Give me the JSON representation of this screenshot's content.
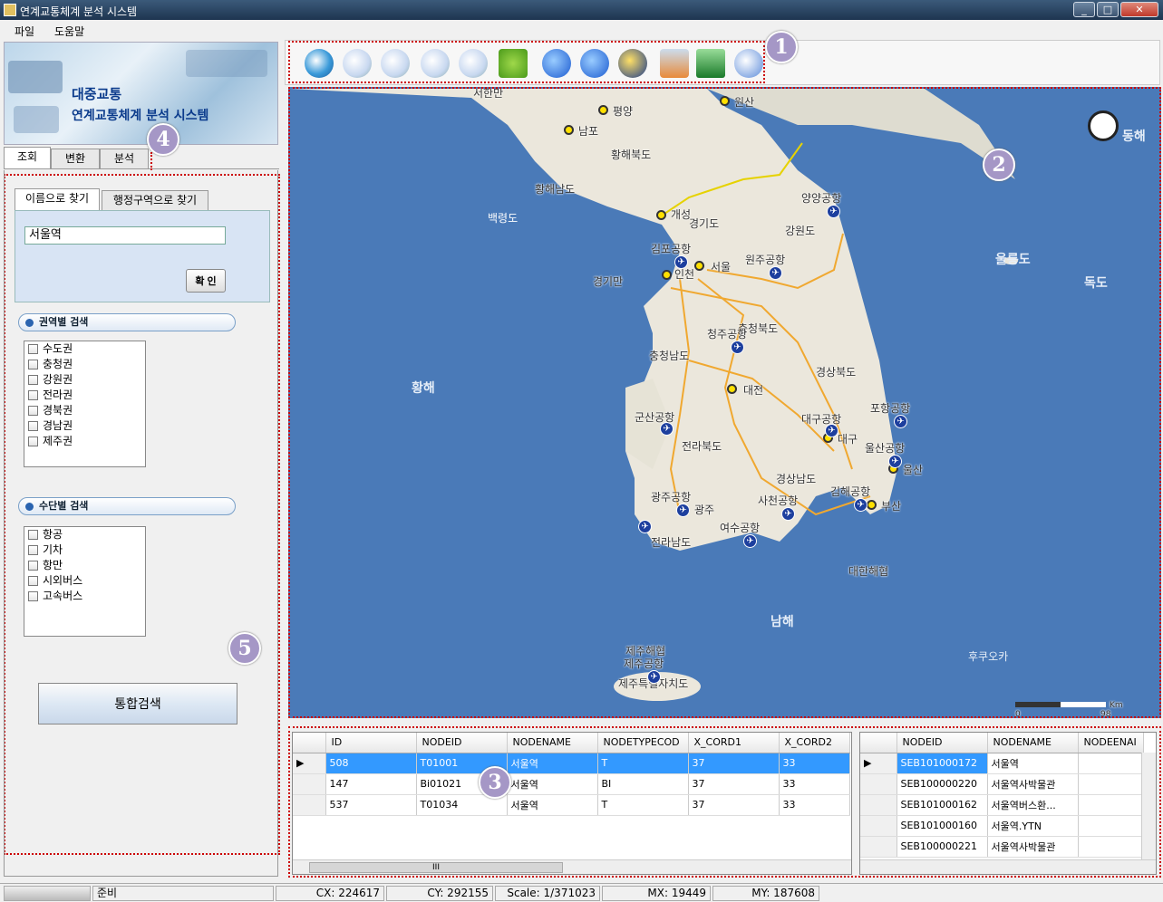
{
  "window": {
    "title": "연계교통체계 분석 시스템"
  },
  "menu": {
    "file": "파일",
    "help": "도움말"
  },
  "banner": {
    "line1": "대중교통",
    "line2": "연계교통체계 분석 시스템"
  },
  "main_tabs": [
    "조회",
    "변환",
    "분석"
  ],
  "search_tabs": [
    "이름으로 찾기",
    "행정구역으로 찾기"
  ],
  "search": {
    "value": "서울역",
    "confirm": "확 인"
  },
  "region_section": {
    "title": "권역별 검색",
    "items": [
      "수도권",
      "충청권",
      "강원권",
      "전라권",
      "경북권",
      "경남권",
      "제주권"
    ]
  },
  "mode_section": {
    "title": "수단별 검색",
    "items": [
      "항공",
      "기차",
      "항만",
      "시외버스",
      "고속버스"
    ]
  },
  "integrated_search": "통합검색",
  "badges": [
    "1",
    "2",
    "3",
    "4",
    "5"
  ],
  "map": {
    "sea_labels": [
      "황해",
      "남해",
      "동해",
      "울릉도",
      "독도",
      "후쿠오카",
      "서한만"
    ],
    "region_labels": [
      "황해북도",
      "황해남도",
      "경기도",
      "강원도",
      "충청북도",
      "충청남도",
      "경상북도",
      "전라북도",
      "경상남도",
      "전라남도",
      "대한해협",
      "제주해협",
      "제주특별자치도",
      "경기만",
      "백령도"
    ],
    "cities": [
      "평양",
      "남포",
      "원산",
      "개성",
      "서울",
      "인천",
      "대전",
      "대구",
      "울산",
      "부산",
      "광주"
    ],
    "airports": [
      "양양공항",
      "김포공항",
      "원주공항",
      "청주공항",
      "군산공항",
      "대구공항",
      "포항공항",
      "울산공항",
      "김해공항",
      "광주공항",
      "사천공항",
      "여수공항",
      "제주공항"
    ],
    "scale_left": "0",
    "scale_right": "98",
    "scale_unit": "Km"
  },
  "grid_left": {
    "columns": [
      "ID",
      "NODEID",
      "NODENAME",
      "NODETYPECOD",
      "X_CORD1",
      "X_CORD2"
    ],
    "rows": [
      [
        "508",
        "T01001",
        "서울역",
        "T",
        "37",
        "33"
      ],
      [
        "147",
        "Bi01021",
        "서울역",
        "BI",
        "37",
        "33"
      ],
      [
        "537",
        "T01034",
        "서울역",
        "T",
        "37",
        "33"
      ]
    ],
    "scroll_mark": "III"
  },
  "grid_right": {
    "columns": [
      "NODEID",
      "NODENAME",
      "NODEENAI"
    ],
    "rows": [
      [
        "SEB101000172",
        "서울역",
        ""
      ],
      [
        "SEB100000220",
        "서울역사박물관",
        ""
      ],
      [
        "SEB101000162",
        "서울역버스환...",
        ""
      ],
      [
        "SEB101000160",
        "서울역.YTN",
        ""
      ],
      [
        "SEB100000221",
        "서울역사박물관",
        ""
      ]
    ]
  },
  "status": {
    "ready": "준비",
    "cx": "CX: 224617",
    "cy": "CY: 292155",
    "scale": "Scale: 1/371023",
    "mx": "MX: 19449",
    "my": "MY: 187608"
  },
  "colors": {
    "titlebar": "#1e3550",
    "selection": "#3399ff",
    "annotation_dotted": "#cc0000",
    "badge": "#a597c6",
    "sea": "#4a7ab8",
    "land": "#ebe7dc"
  }
}
